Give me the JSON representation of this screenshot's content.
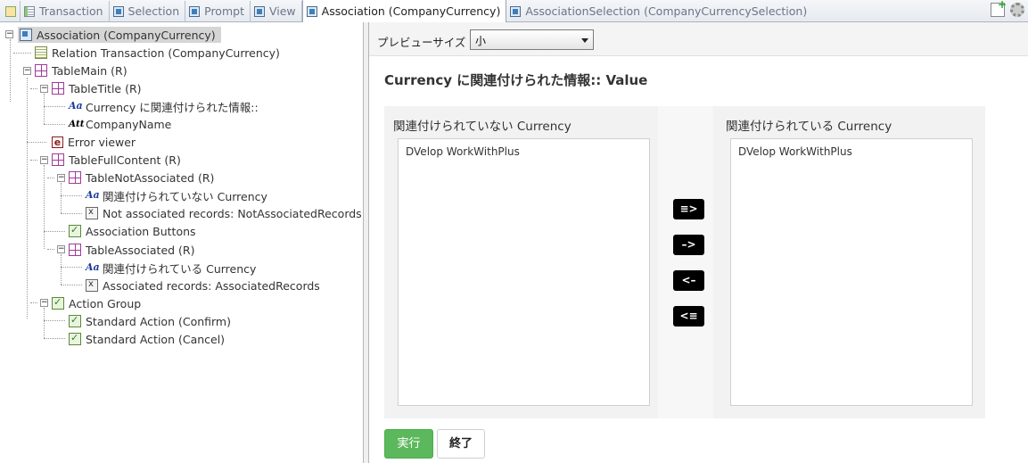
{
  "tabs": [
    {
      "label": "Transaction",
      "icon": "transaction-icon"
    },
    {
      "label": "Selection",
      "icon": "object-icon"
    },
    {
      "label": "Prompt",
      "icon": "object-icon"
    },
    {
      "label": "View",
      "icon": "object-icon"
    },
    {
      "label": "Association (CompanyCurrency)",
      "icon": "object-icon",
      "active": true
    },
    {
      "label": "AssociationSelection (CompanyCurrencySelection)",
      "icon": "object-icon"
    }
  ],
  "tree": {
    "root": "Association (CompanyCurrency)",
    "relation_transaction": "Relation Transaction (CompanyCurrency)",
    "table_main": "TableMain (R)",
    "table_title": "TableTitle (R)",
    "title_text": "Currency に関連付けられた情報::",
    "company_name": "CompanyName",
    "error_viewer": "Error viewer",
    "table_full_content": "TableFullContent (R)",
    "table_not_associated": "TableNotAssociated (R)",
    "not_assoc_text": "関連付けられていない Currency",
    "not_assoc_records": "Not associated records: NotAssociatedRecords",
    "association_buttons": "Association Buttons",
    "table_associated": "TableAssociated (R)",
    "assoc_text": "関連付けられている Currency",
    "assoc_records": "Associated records: AssociatedRecords",
    "action_group": "Action Group",
    "confirm_action": "Standard Action (Confirm)",
    "cancel_action": "Standard Action (Cancel)",
    "toggle_minus": "−"
  },
  "preview": {
    "size_label": "プレビューサイズ",
    "size_value": "小",
    "heading": "Currency に関連付けられた情報:: Value",
    "not_associated_title": "関連付けられていない Currency",
    "associated_title": "関連付けられている Currency",
    "not_associated_items": [
      "DVelop WorkWithPlus"
    ],
    "associated_items": [
      "DVelop WorkWithPlus"
    ],
    "buttons": {
      "add_all": "≡>",
      "add": "–>",
      "remove": "<–",
      "remove_all": "<≡",
      "run": "実行",
      "close": "終了"
    }
  },
  "colors": {
    "run_button": "#5cb85c",
    "table_icon": "#a03a9a",
    "selected_node": "#d5d5d5"
  }
}
